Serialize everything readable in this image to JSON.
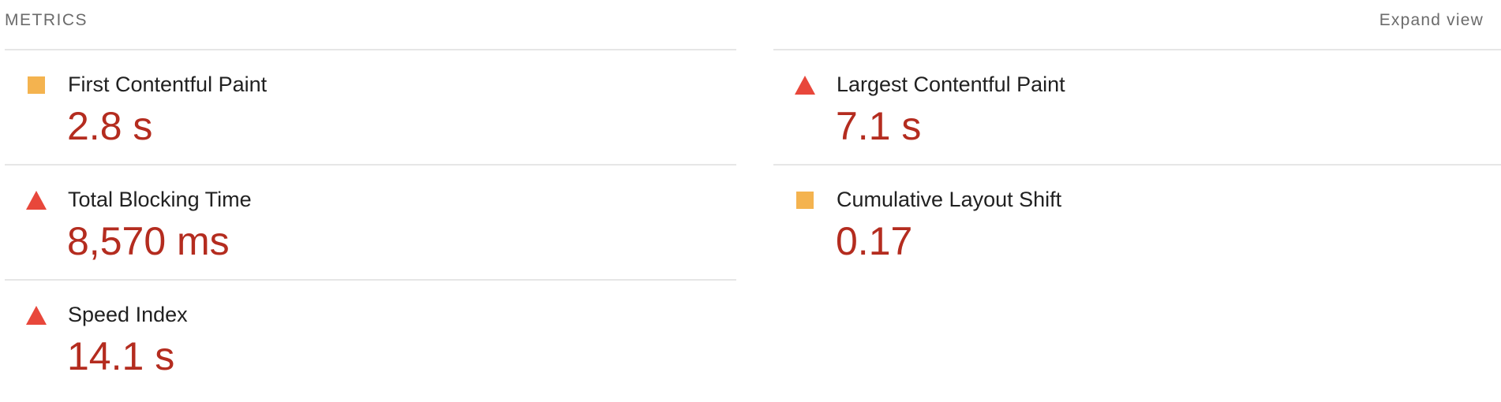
{
  "header": {
    "title": "METRICS",
    "expand_label": "Expand view"
  },
  "colors": {
    "average": "#f4b34f",
    "fail": "#e8473b",
    "value_text": "#b42c1f"
  },
  "metrics": {
    "left": [
      {
        "label": "First Contentful Paint",
        "value": "2.8 s",
        "status_icon": "orange-square-icon"
      },
      {
        "label": "Total Blocking Time",
        "value": "8,570 ms",
        "status_icon": "red-triangle-icon"
      },
      {
        "label": "Speed Index",
        "value": "14.1 s",
        "status_icon": "red-triangle-icon"
      }
    ],
    "right": [
      {
        "label": "Largest Contentful Paint",
        "value": "7.1 s",
        "status_icon": "red-triangle-icon"
      },
      {
        "label": "Cumulative Layout Shift",
        "value": "0.17",
        "status_icon": "orange-square-icon"
      }
    ]
  }
}
